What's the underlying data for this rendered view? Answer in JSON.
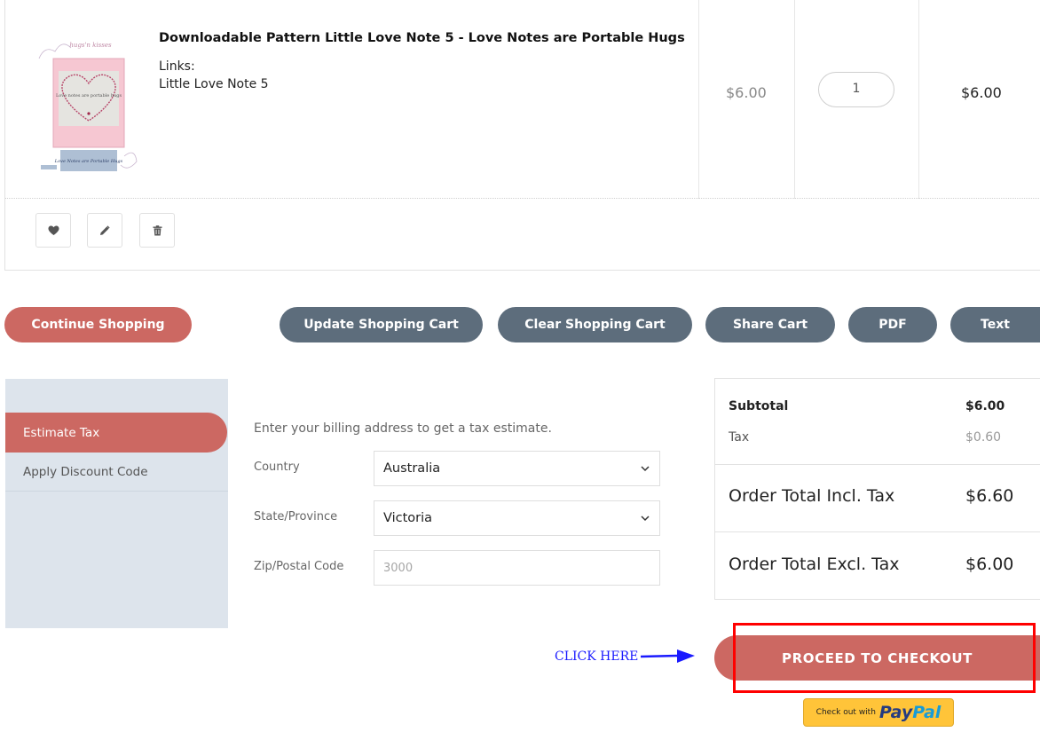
{
  "cart_item": {
    "name": "Downloadable Pattern Little Love Note 5 - Love Notes are Portable Hugs",
    "links_label": "Links:",
    "link_title": "Little Love Note 5",
    "unit_price": "$6.00",
    "quantity": "1",
    "row_subtotal": "$6.00",
    "thumbnail": {
      "brand": "hugs'n kisses",
      "heart_text": "Love notes are portable hugs",
      "caption": "Love Notes are Portable Hugs"
    },
    "actions": [
      {
        "icon": "heart-icon"
      },
      {
        "icon": "pencil-icon"
      },
      {
        "icon": "trash-icon"
      }
    ]
  },
  "cart_buttons": {
    "continue": "Continue Shopping",
    "update": "Update Shopping Cart",
    "clear": "Clear Shopping Cart",
    "share": "Share Cart",
    "pdf": "PDF",
    "text": "Text"
  },
  "tax_panel": {
    "tabs": [
      "Estimate Tax",
      "Apply Discount Code"
    ],
    "intro": "Enter your billing address to get a tax estimate.",
    "country_label": "Country",
    "country_value": "Australia",
    "state_label": "State/Province",
    "state_value": "Victoria",
    "zip_label": "Zip/Postal Code",
    "zip_placeholder": "3000"
  },
  "totals": {
    "subtotal_label": "Subtotal",
    "subtotal_value": "$6.00",
    "tax_label": "Tax",
    "tax_value": "$0.60",
    "incl_label": "Order Total Incl. Tax",
    "incl_value": "$6.60",
    "excl_label": "Order Total Excl. Tax",
    "excl_value": "$6.00"
  },
  "checkout": {
    "annotation": "CLICK HERE",
    "button": "PROCEED TO CHECKOUT",
    "paypal_small": "Check out with",
    "paypal_pay": "Pay",
    "paypal_pal": "Pal"
  },
  "colors": {
    "accent_red": "#cc6862",
    "slate": "#5d6d7c",
    "panel_bg": "#dde4ec",
    "annotation_blue": "#1a1aff",
    "highlight_red": "#ff0000",
    "paypal_yellow": "#ffc439"
  }
}
